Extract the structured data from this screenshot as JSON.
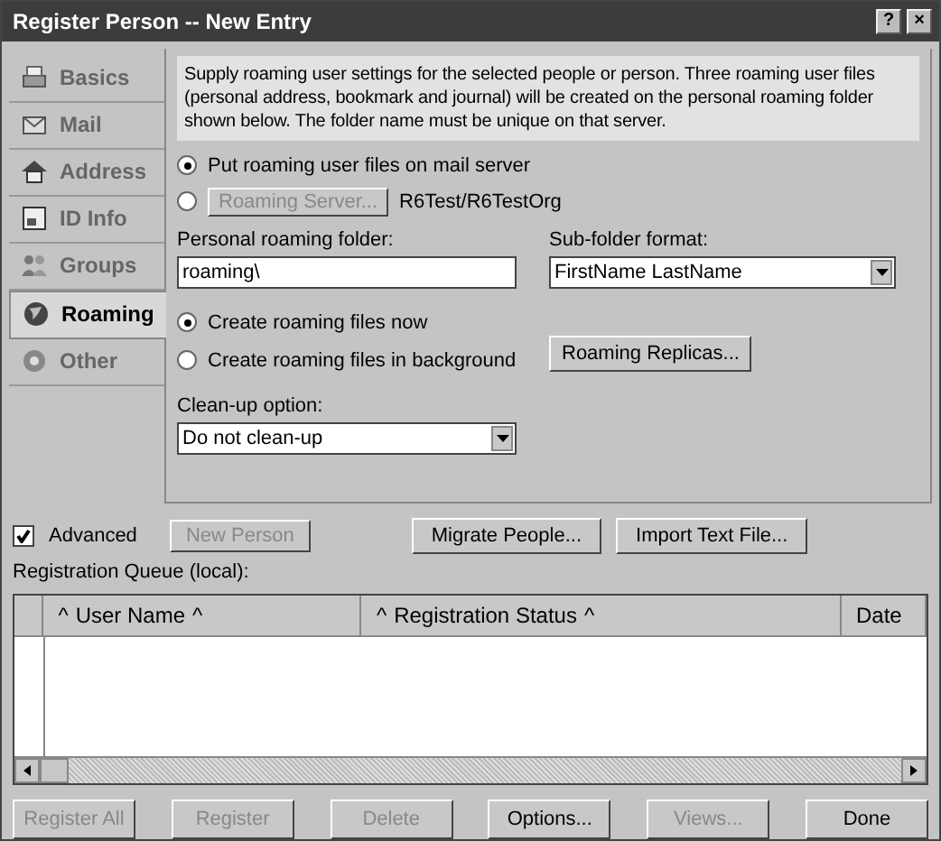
{
  "window": {
    "title": "Register Person -- New Entry",
    "controls": [
      "?",
      "×"
    ]
  },
  "tabs": [
    {
      "label": "Basics",
      "kind": "printer",
      "selected": false
    },
    {
      "label": "Mail",
      "kind": "mail",
      "selected": false
    },
    {
      "label": "Address",
      "kind": "house",
      "selected": false
    },
    {
      "label": "ID Info",
      "kind": "card",
      "selected": false
    },
    {
      "label": "Groups",
      "kind": "people",
      "selected": false
    },
    {
      "label": "Roaming",
      "kind": "globe",
      "selected": true
    },
    {
      "label": "Other",
      "kind": "gear",
      "selected": false
    }
  ],
  "info": "Supply roaming user settings for the selected people or person. Three roaming user files (personal address, bookmark and journal) will be created on the personal roaming folder shown below.  The folder name must be unique on that server.",
  "location": {
    "options": [
      {
        "label": "Put roaming user files on mail server",
        "selected": true
      },
      {
        "button": "Roaming Server...",
        "disabled": true,
        "value": "R6Test/R6TestOrg",
        "selected": false
      }
    ]
  },
  "personal_folder": {
    "label": "Personal roaming folder:",
    "value": "roaming\\"
  },
  "subfolder_format": {
    "label": "Sub-folder format:",
    "value": "FirstName LastName"
  },
  "create": {
    "options": [
      {
        "label": "Create roaming files now",
        "selected": true
      },
      {
        "label": "Create roaming files in background",
        "selected": false
      }
    ]
  },
  "replicas_button": {
    "label": "Roaming Replicas...",
    "disabled": false
  },
  "cleanup": {
    "label": "Clean-up option:",
    "value": "Do not clean-up"
  },
  "advanced": {
    "label": "Advanced",
    "checked": true
  },
  "top_buttons": [
    {
      "label": "New Person",
      "disabled": true
    },
    {
      "label": "Migrate People...",
      "disabled": false
    },
    {
      "label": "Import Text File...",
      "disabled": false
    }
  ],
  "queue": {
    "label": "Registration Queue (local):",
    "columns": [
      {
        "before": "^",
        "label": "User Name",
        "after": "^"
      },
      {
        "before": "^",
        "label": "Registration Status",
        "after": "^"
      },
      {
        "label": "Date"
      }
    ]
  },
  "bottom_buttons": [
    {
      "label": "Register All",
      "disabled": true
    },
    {
      "label": "Register",
      "disabled": true
    },
    {
      "label": "Delete",
      "disabled": true
    },
    {
      "label": "Options...",
      "disabled": false
    },
    {
      "label": "Views...",
      "disabled": true
    },
    {
      "label": "Done",
      "disabled": false
    }
  ]
}
